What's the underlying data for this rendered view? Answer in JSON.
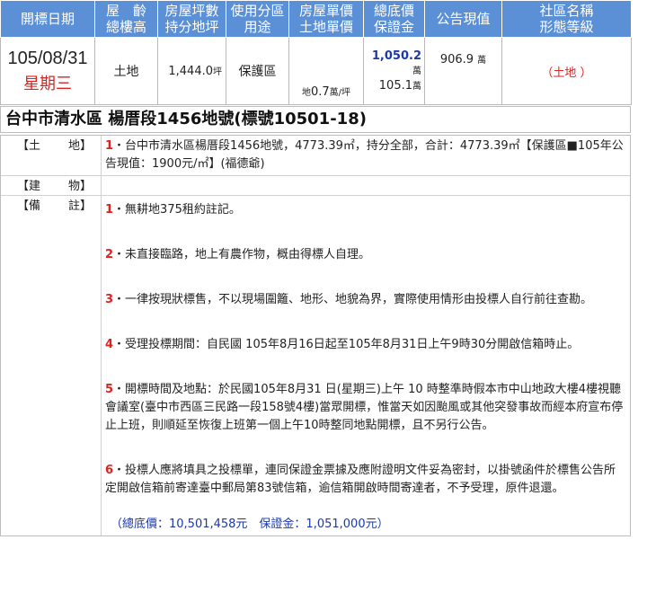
{
  "headers": [
    {
      "l1": "開標日期",
      "l2": ""
    },
    {
      "l1": "屋　齡",
      "l2": "總樓高"
    },
    {
      "l1": "房屋坪數",
      "l2": "持分地坪"
    },
    {
      "l1": "使用分區",
      "l2": "用途"
    },
    {
      "l1": "房屋單價",
      "l2": "土地單價"
    },
    {
      "l1": "總底價",
      "l2": "保證金"
    },
    {
      "l1": "公告現值",
      "l2": ""
    },
    {
      "l1": "社區名稱",
      "l2": "形態等級"
    }
  ],
  "row": {
    "date": "105/08/31",
    "weekday": "星期三",
    "age": "土地",
    "area": "1,444.0",
    "area_unit": "坪",
    "zone": "保護區",
    "unit_price_prefix": "地",
    "unit_price": "0.7",
    "unit_price_unit": "萬/坪",
    "total_price": "1,050.2",
    "total_unit": "萬",
    "deposit": "105.1",
    "deposit_unit": "萬",
    "announced_value": "906.9",
    "announced_unit": "萬",
    "community": "（土地 ）"
  },
  "case_title": "台中市清水區 楊厝段1456地號(標號10501-18)",
  "land": {
    "label_left": "【土",
    "label_right": "地】",
    "num": "1",
    "text": "・台中市清水區楊厝段1456地號，4773.39㎡，持分全部，合計：4773.39㎡【保護區■105年公告現值：1900元/㎡】(福德爺)"
  },
  "building": {
    "label_left": "【建",
    "label_right": "物】"
  },
  "notes": {
    "label_left": "【備",
    "label_right": "註】",
    "items": [
      {
        "num": "1",
        "text": "・無耕地375租約註記。"
      },
      {
        "num": "2",
        "text": "・未直接臨路，地上有農作物，概由得標人自理。"
      },
      {
        "num": "3",
        "text": "・一律按現狀標售，不以現場圍籬、地形、地貌為界，實際使用情形由投標人自行前往查勘。"
      },
      {
        "num": "4",
        "text": "・受理投標期間：自民國 105年8月16日起至105年8月31日上午9時30分開啟信箱時止。"
      },
      {
        "num": "5",
        "text": "・開標時間及地點：於民國105年8月31 日(星期三)上午 10 時整準時假本市中山地政大樓4樓視聽會議室(臺中市西區三民路一段158號4樓)當眾開標，惟當天如因颱風或其他突發事故而經本府宣布停止上班，則順延至恢復上班第一個上午10時整同地點開標，且不另行公告。"
      },
      {
        "num": "6",
        "text": "・投標人應將填具之投標單，連同保證金票據及應附證明文件妥為密封，以掛號函件於標售公告所定開啟信箱前寄達臺中郵局第83號信箱，逾信箱開啟時間寄達者，不予受理，原件退還。"
      }
    ],
    "footer": "（總底價：10,501,458元　保證金：1,051,000元）"
  }
}
